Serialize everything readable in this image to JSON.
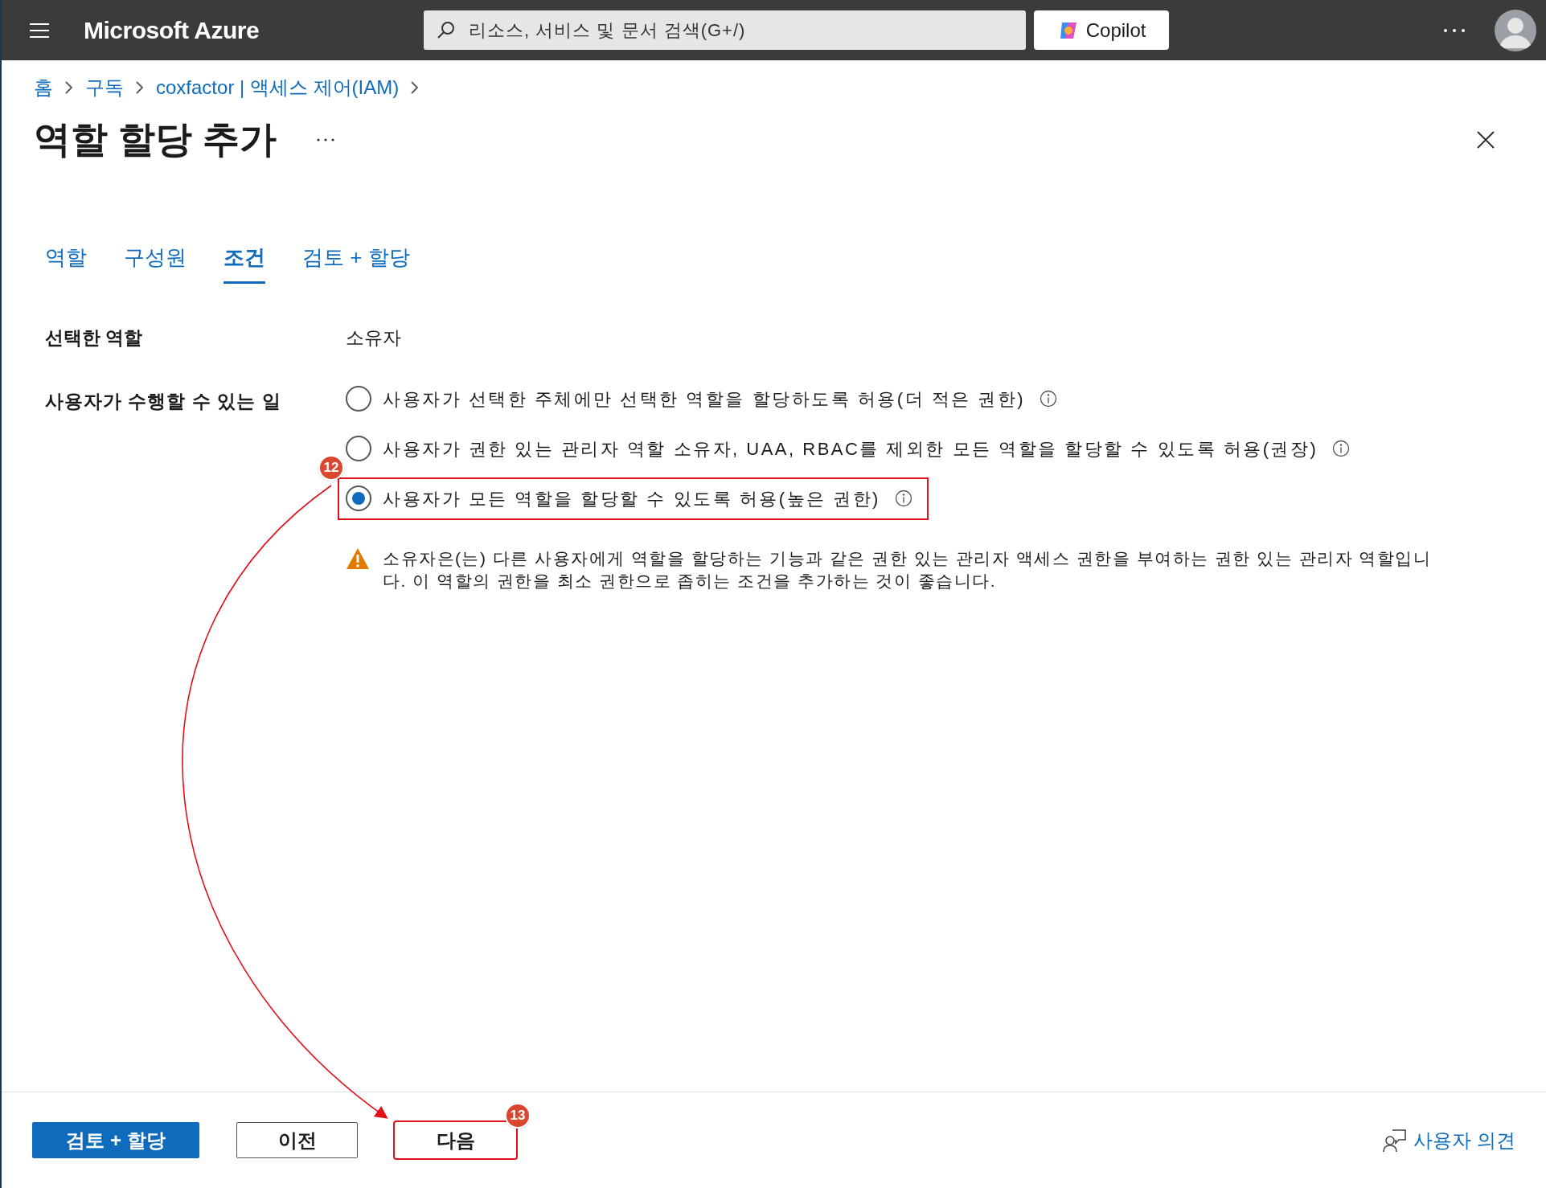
{
  "top_bar": {
    "brand": "Microsoft Azure",
    "search": {
      "placeholder": "리소스, 서비스 및 문서 검색(G+/)"
    },
    "copilot": "Copilot"
  },
  "breadcrumb": [
    "홈",
    "구독",
    "coxfactor | 액세스 제어(IAM)"
  ],
  "title": "역할 할당 추가",
  "tabs": [
    {
      "label": "역할",
      "selected": false
    },
    {
      "label": "구성원",
      "selected": false
    },
    {
      "label": "조건",
      "selected": true
    },
    {
      "label": "검토 + 할당",
      "selected": false
    }
  ],
  "selected_role": {
    "label": "선택한 역할",
    "value": "소유자"
  },
  "permission": {
    "label": "사용자가 수행할 수 있는 일",
    "options": [
      {
        "label": "사용자가 선택한 주체에만 선택한 역할을 할당하도록 허용(더 적은 권한)",
        "selected": false
      },
      {
        "label": "사용자가 권한 있는 관리자 역할 소유자, UAA, RBAC를 제외한 모든 역할을 할당할 수 있도록 허용(권장)",
        "selected": false
      },
      {
        "label": "사용자가 모든 역할을 할당할 수 있도록 허용(높은 권한)",
        "selected": true,
        "annotation": "12"
      }
    ]
  },
  "warning": "소유자은(는) 다른 사용자에게 역할을 할당하는 기능과 같은 권한 있는 관리자 액세스 권한을 부여하는 권한 있는 관리자 역할입니다. 이 역할의 권한을 최소 권한으로 좁히는 조건을 추가하는 것이 좋습니다.",
  "footer": {
    "buttons": [
      {
        "label": "검토 + 할당",
        "kind": "primary"
      },
      {
        "label": "이전",
        "kind": "secondary"
      },
      {
        "label": "다음",
        "kind": "secondary",
        "annotation": "13"
      }
    ],
    "feedback": "사용자 의견"
  }
}
